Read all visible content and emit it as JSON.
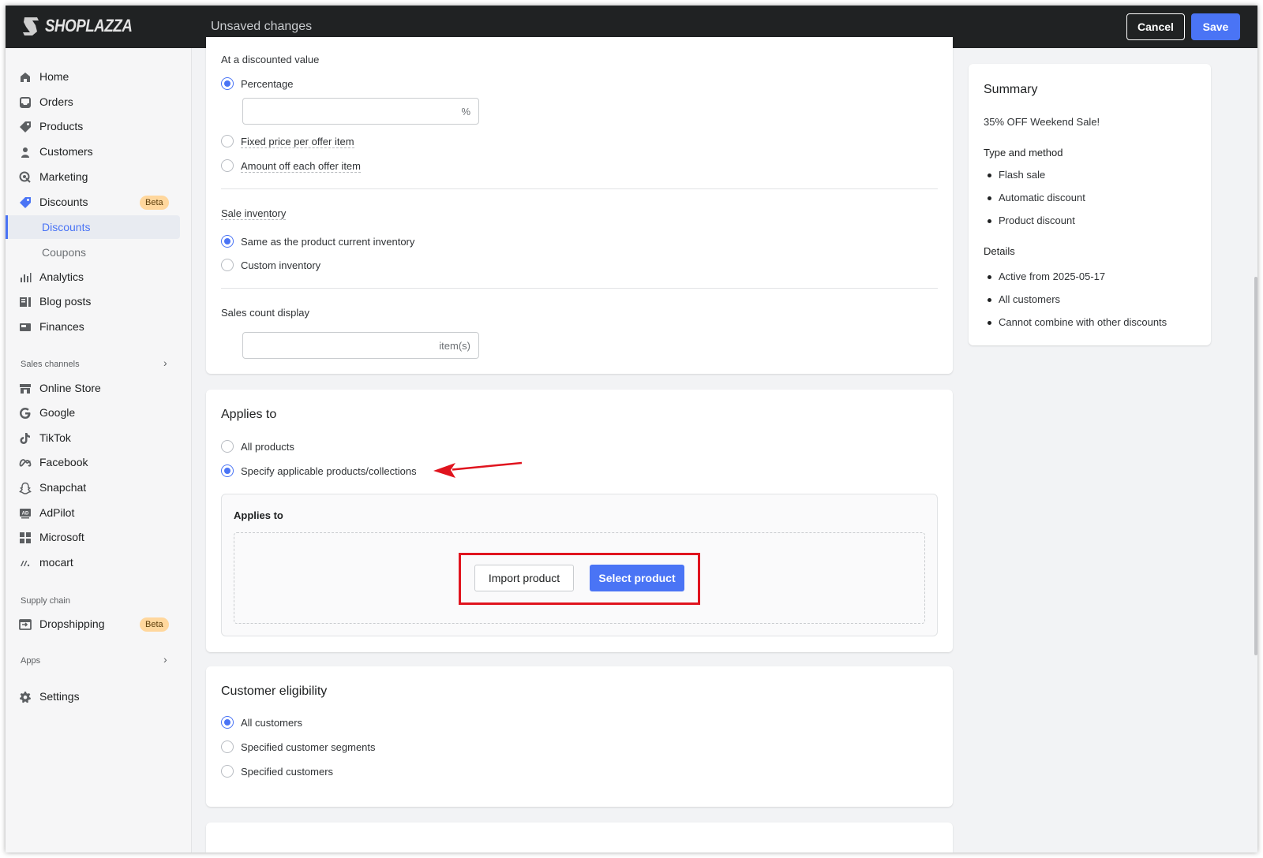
{
  "topbar": {
    "brand": "SHOPLAZZA",
    "status": "Unsaved changes",
    "cancel_label": "Cancel",
    "save_label": "Save",
    "accent_color": "#4a74f5"
  },
  "sidebar": {
    "items": [
      {
        "label": "Home",
        "icon": "home-icon"
      },
      {
        "label": "Orders",
        "icon": "inbox-icon"
      },
      {
        "label": "Products",
        "icon": "tag-icon"
      },
      {
        "label": "Customers",
        "icon": "person-icon"
      },
      {
        "label": "Marketing",
        "icon": "target-icon"
      },
      {
        "label": "Discounts",
        "icon": "discount-tag-icon",
        "badge": "Beta"
      },
      {
        "label": "Analytics",
        "icon": "bar-chart-icon"
      },
      {
        "label": "Blog posts",
        "icon": "blog-icon"
      },
      {
        "label": "Finances",
        "icon": "finance-icon"
      }
    ],
    "discount_subitems": [
      {
        "label": "Discounts",
        "active": true
      },
      {
        "label": "Coupons",
        "active": false
      }
    ],
    "sales_channels_heading": "Sales channels",
    "channels": [
      {
        "label": "Online Store",
        "icon": "store-icon"
      },
      {
        "label": "Google",
        "icon": "google-icon"
      },
      {
        "label": "TikTok",
        "icon": "tiktok-icon"
      },
      {
        "label": "Facebook",
        "icon": "meta-icon"
      },
      {
        "label": "Snapchat",
        "icon": "ghost-icon"
      },
      {
        "label": "AdPilot",
        "icon": "ad-icon"
      },
      {
        "label": "Microsoft",
        "icon": "grid-icon"
      },
      {
        "label": "mocart",
        "icon": "mocart-icon"
      }
    ],
    "supply_chain_heading": "Supply chain",
    "supply": [
      {
        "label": "Dropshipping",
        "icon": "dropship-icon",
        "badge": "Beta"
      }
    ],
    "apps_heading": "Apps",
    "settings_label": "Settings"
  },
  "pricing_card": {
    "discounted_value_label": "At a discounted value",
    "options": [
      "Percentage",
      "Fixed price per offer item",
      "Amount off each offer item"
    ],
    "selected_option": "Percentage",
    "percentage_value": "",
    "percentage_suffix": "%",
    "sale_inventory_label": "Sale inventory",
    "inventory_options": [
      "Same as the product current inventory",
      "Custom inventory"
    ],
    "selected_inventory": "Same as the product current inventory",
    "sales_count_label": "Sales count display",
    "sales_count_value": "",
    "sales_count_suffix": "item(s)"
  },
  "applies_card": {
    "title": "Applies to",
    "options": [
      "All products",
      "Specify applicable products/collections"
    ],
    "selected_option": "Specify applicable products/collections",
    "subcard_title": "Applies to",
    "import_label": "Import product",
    "select_label": "Select product"
  },
  "eligibility_card": {
    "title": "Customer eligibility",
    "options": [
      "All customers",
      "Specified customer segments",
      "Specified customers"
    ],
    "selected_option": "All customers"
  },
  "summary": {
    "title": "Summary",
    "name": "35% OFF Weekend Sale!",
    "type_heading": "Type and method",
    "type_items": [
      "Flash sale",
      "Automatic discount",
      "Product discount"
    ],
    "details_heading": "Details",
    "details_items": [
      "Active from 2025-05-17",
      "All customers",
      "Cannot combine with other discounts"
    ]
  },
  "annotation_color": "#e0141e"
}
